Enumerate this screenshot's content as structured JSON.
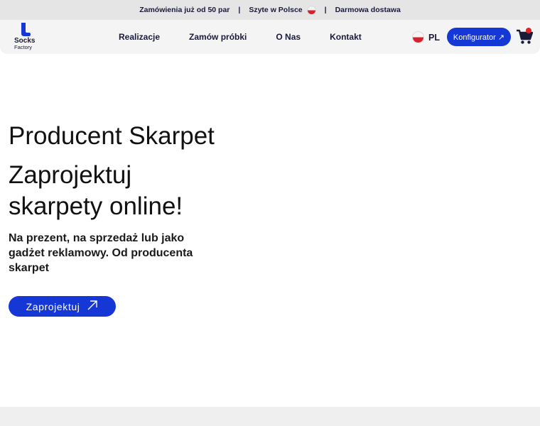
{
  "topbar": {
    "item1": "Zamówienia już od 50 par",
    "separator": "|",
    "item2": "Szyte w Polsce",
    "item3": "Darmowa dostawa"
  },
  "logo": {
    "line1": "Socks",
    "line2": "Factory"
  },
  "nav": {
    "items": [
      {
        "label": "Realizacje"
      },
      {
        "label": "Zamów próbki"
      },
      {
        "label": "O Nas"
      },
      {
        "label": "Kontakt"
      }
    ]
  },
  "lang": {
    "code": "PL"
  },
  "configurator": {
    "label": "Konfigurator ↗"
  },
  "hero": {
    "title": "Producent Skarpet",
    "headline": "Zaprojektuj skarpety online!",
    "subtitle": "Na prezent, na sprzedaż lub jako gadżet reklamowy. Od producenta skarpet",
    "cta_label": "Zaprojektuj"
  },
  "colors": {
    "accent": "#1537d6",
    "flag_red": "#d6202c",
    "badge": "#e02424"
  },
  "icons": [
    "sock-logo-icon",
    "poland-flag-icon",
    "cart-icon",
    "arrow-up-right-icon"
  ]
}
